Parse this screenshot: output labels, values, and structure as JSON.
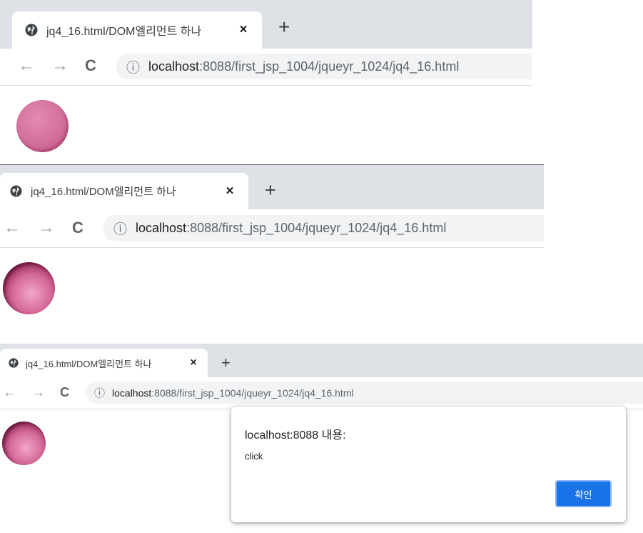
{
  "screens": [
    {
      "tab_title": "jq4_16.html/DOM엘리먼트 하나",
      "tab_close": "×",
      "new_tab": "+",
      "nav_back": "←",
      "nav_forward": "→",
      "nav_reload": "C",
      "info_icon": "ⓘ",
      "url_host": "localhost",
      "url_path": ":8088/first_jsp_1004/jqueyr_1024/jq4_16.html"
    },
    {
      "tab_title": "jq4_16.html/DOM엘리먼트 하나",
      "tab_close": "×",
      "new_tab": "+",
      "nav_back": "←",
      "nav_forward": "→",
      "nav_reload": "C",
      "info_icon": "ⓘ",
      "url_host": "localhost",
      "url_path": ":8088/first_jsp_1004/jqueyr_1024/jq4_16.html"
    },
    {
      "tab_title": "jq4_16.html/DOM엘리먼트 하나",
      "tab_close": "×",
      "new_tab": "+",
      "nav_back": "←",
      "nav_forward": "→",
      "nav_reload": "C",
      "info_icon": "ⓘ",
      "url_host": "localhost",
      "url_path": ":8088/first_jsp_1004/jqueyr_1024/jq4_16.html"
    }
  ],
  "alert": {
    "title": "localhost:8088 내용:",
    "message": "click",
    "ok_label": "확인"
  },
  "colors": {
    "tabstrip": "#dee1e6",
    "omnibox": "#f1f3f4",
    "ball_flat": "#d36f9c",
    "ball_pressed": "#8e1f52",
    "ok_button": "#1a73e8"
  }
}
